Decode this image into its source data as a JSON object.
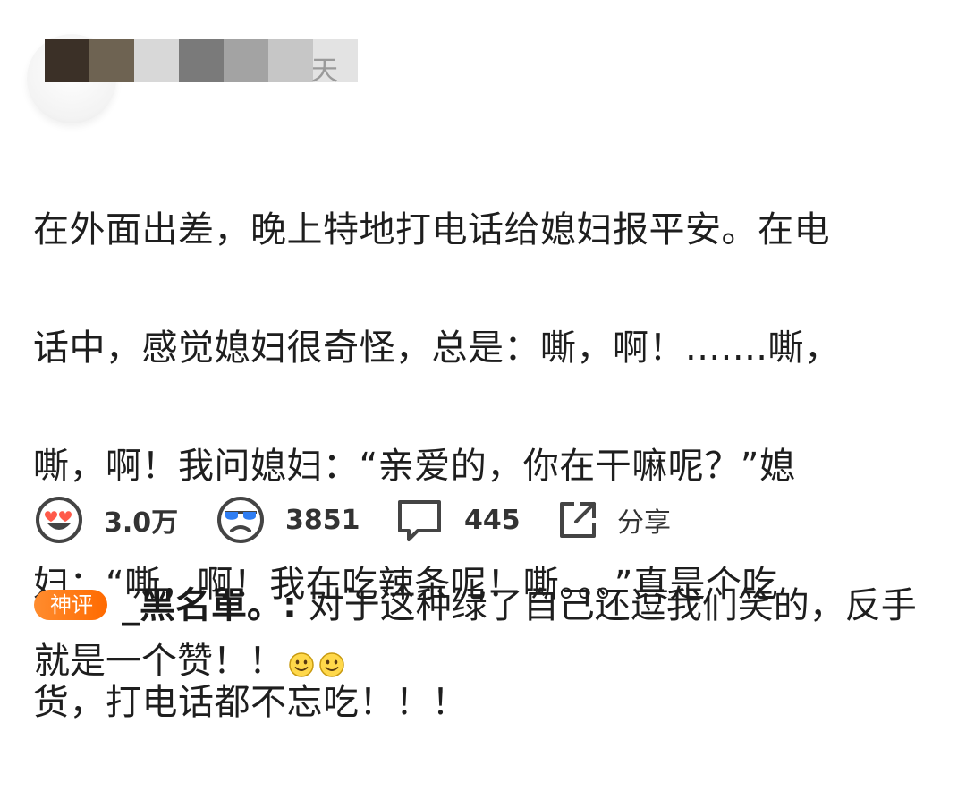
{
  "header": {
    "username_visible_fragment": "天",
    "blur_colors": [
      "#3b3027",
      "#6e6352",
      "#d8d8d8",
      "#7a7a7a",
      "#a3a3a3",
      "#b3b3b3",
      "#e3e3e3"
    ]
  },
  "post": {
    "lines": [
      "在外面出差，晚上特地打电话给媳妇报平安。在电",
      "话中，感觉媳妇很奇怪，总是：嘶，啊！.......嘶，",
      "嘶，啊！我问媳妇：“亲爱的，你在干嘛呢？”媳",
      "妇：“嘶，啊！我在吃辣条呢！嘶。。。”真是个吃",
      "货，打电话都不忘吃！！！"
    ]
  },
  "actions": {
    "like_icon": "heart-eyes-face-icon",
    "like_count": "3.0万",
    "dislike_icon": "sunglasses-frown-face-icon",
    "dislike_count": "3851",
    "comment_icon": "speech-bubble-icon",
    "comment_count": "445",
    "share_icon": "share-arrow-icon",
    "share_label": "分享"
  },
  "god_comment": {
    "badge": "神评",
    "commenter": "_黑名單。:",
    "text": " 对于这种绿了自己还逗我们笑的，反手就是一个赞！！",
    "emojis": [
      "smile-face-icon",
      "smile-face-icon"
    ]
  },
  "colors": {
    "accent_orange": "#ff7a1a",
    "text": "#1e1e1e",
    "icon_gray": "#444444"
  }
}
